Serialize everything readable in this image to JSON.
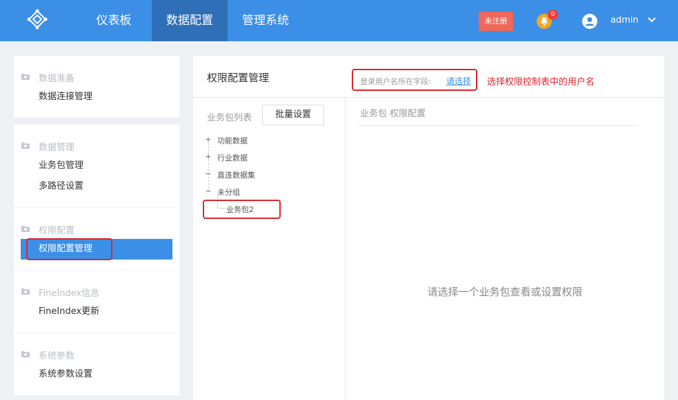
{
  "header": {
    "logo_icon": "diamond-logo-icon",
    "nav": [
      "仪表板",
      "数据配置",
      "管理系统"
    ],
    "active_nav": "数据配置",
    "unregistered_label": "未注册",
    "notification_count": "0",
    "username": "admin"
  },
  "sidebar": {
    "sections": [
      {
        "title": "数据准备",
        "items": [
          "数据连接管理"
        ]
      },
      {
        "title": "数据管理",
        "items": [
          "业务包管理",
          "多路径设置"
        ]
      },
      {
        "title": "权限配置",
        "items": [
          "权限配置管理"
        ]
      },
      {
        "title": "FineIndex信息",
        "items": [
          "FineIndex更新"
        ]
      },
      {
        "title": "系统参数",
        "items": [
          "系统参数设置"
        ]
      }
    ],
    "active_item": "权限配置管理"
  },
  "main": {
    "title": "权限配置管理",
    "field_label": "登录用户名所在字段:",
    "field_link": "请选择",
    "annotation": "选择权限控制表中的用户名",
    "list_title": "业务包列表",
    "batch_button": "批量设置",
    "tree": [
      {
        "label": "功能数据",
        "symbol": "+"
      },
      {
        "label": "行业数据",
        "symbol": "+"
      },
      {
        "label": "直连数据集",
        "symbol": "−"
      },
      {
        "label": "未分组",
        "symbol": "−"
      },
      {
        "label": "业务包2",
        "symbol": ""
      }
    ],
    "config_title": "业务包 权限配置",
    "empty_hint": "请选择一个业务包查看或设置权限"
  },
  "colors": {
    "brand": "#3b8fe6",
    "nav_active": "#2f6fb8",
    "unregistered": "#f0675b",
    "bell": "#f5a623",
    "annotation": "#d9262c"
  }
}
